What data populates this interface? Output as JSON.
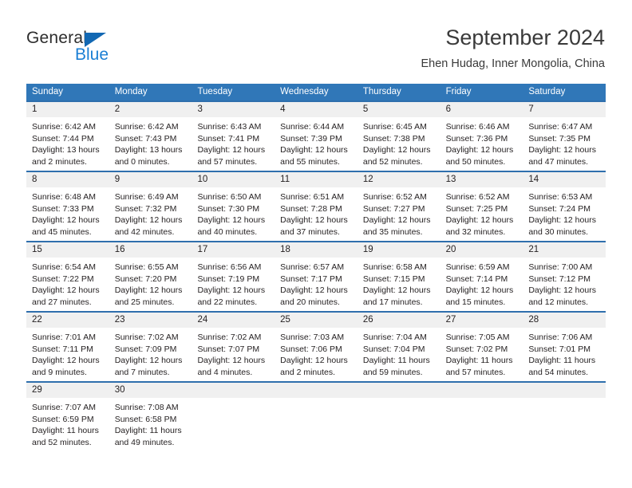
{
  "brand": {
    "name_part1": "General",
    "name_part2": "Blue",
    "logo_icon": "blue-triangle-icon"
  },
  "header": {
    "title": "September 2024",
    "subtitle": "Ehen Hudag, Inner Mongolia, China"
  },
  "colors": {
    "header_blue": "#3077b8",
    "row_divider_blue": "#2f6fad",
    "day_number_bg": "#f0f0f0",
    "logo_blue": "#1b7fd4",
    "text": "#231f20"
  },
  "weekdays": [
    "Sunday",
    "Monday",
    "Tuesday",
    "Wednesday",
    "Thursday",
    "Friday",
    "Saturday"
  ],
  "labels": {
    "sunrise": "Sunrise:",
    "sunset": "Sunset:",
    "daylight": "Daylight:"
  },
  "weeks": [
    [
      {
        "day": "1",
        "sunrise": "Sunrise: 6:42 AM",
        "sunset": "Sunset: 7:44 PM",
        "daylight_l1": "Daylight: 13 hours",
        "daylight_l2": "and 2 minutes."
      },
      {
        "day": "2",
        "sunrise": "Sunrise: 6:42 AM",
        "sunset": "Sunset: 7:43 PM",
        "daylight_l1": "Daylight: 13 hours",
        "daylight_l2": "and 0 minutes."
      },
      {
        "day": "3",
        "sunrise": "Sunrise: 6:43 AM",
        "sunset": "Sunset: 7:41 PM",
        "daylight_l1": "Daylight: 12 hours",
        "daylight_l2": "and 57 minutes."
      },
      {
        "day": "4",
        "sunrise": "Sunrise: 6:44 AM",
        "sunset": "Sunset: 7:39 PM",
        "daylight_l1": "Daylight: 12 hours",
        "daylight_l2": "and 55 minutes."
      },
      {
        "day": "5",
        "sunrise": "Sunrise: 6:45 AM",
        "sunset": "Sunset: 7:38 PM",
        "daylight_l1": "Daylight: 12 hours",
        "daylight_l2": "and 52 minutes."
      },
      {
        "day": "6",
        "sunrise": "Sunrise: 6:46 AM",
        "sunset": "Sunset: 7:36 PM",
        "daylight_l1": "Daylight: 12 hours",
        "daylight_l2": "and 50 minutes."
      },
      {
        "day": "7",
        "sunrise": "Sunrise: 6:47 AM",
        "sunset": "Sunset: 7:35 PM",
        "daylight_l1": "Daylight: 12 hours",
        "daylight_l2": "and 47 minutes."
      }
    ],
    [
      {
        "day": "8",
        "sunrise": "Sunrise: 6:48 AM",
        "sunset": "Sunset: 7:33 PM",
        "daylight_l1": "Daylight: 12 hours",
        "daylight_l2": "and 45 minutes."
      },
      {
        "day": "9",
        "sunrise": "Sunrise: 6:49 AM",
        "sunset": "Sunset: 7:32 PM",
        "daylight_l1": "Daylight: 12 hours",
        "daylight_l2": "and 42 minutes."
      },
      {
        "day": "10",
        "sunrise": "Sunrise: 6:50 AM",
        "sunset": "Sunset: 7:30 PM",
        "daylight_l1": "Daylight: 12 hours",
        "daylight_l2": "and 40 minutes."
      },
      {
        "day": "11",
        "sunrise": "Sunrise: 6:51 AM",
        "sunset": "Sunset: 7:28 PM",
        "daylight_l1": "Daylight: 12 hours",
        "daylight_l2": "and 37 minutes."
      },
      {
        "day": "12",
        "sunrise": "Sunrise: 6:52 AM",
        "sunset": "Sunset: 7:27 PM",
        "daylight_l1": "Daylight: 12 hours",
        "daylight_l2": "and 35 minutes."
      },
      {
        "day": "13",
        "sunrise": "Sunrise: 6:52 AM",
        "sunset": "Sunset: 7:25 PM",
        "daylight_l1": "Daylight: 12 hours",
        "daylight_l2": "and 32 minutes."
      },
      {
        "day": "14",
        "sunrise": "Sunrise: 6:53 AM",
        "sunset": "Sunset: 7:24 PM",
        "daylight_l1": "Daylight: 12 hours",
        "daylight_l2": "and 30 minutes."
      }
    ],
    [
      {
        "day": "15",
        "sunrise": "Sunrise: 6:54 AM",
        "sunset": "Sunset: 7:22 PM",
        "daylight_l1": "Daylight: 12 hours",
        "daylight_l2": "and 27 minutes."
      },
      {
        "day": "16",
        "sunrise": "Sunrise: 6:55 AM",
        "sunset": "Sunset: 7:20 PM",
        "daylight_l1": "Daylight: 12 hours",
        "daylight_l2": "and 25 minutes."
      },
      {
        "day": "17",
        "sunrise": "Sunrise: 6:56 AM",
        "sunset": "Sunset: 7:19 PM",
        "daylight_l1": "Daylight: 12 hours",
        "daylight_l2": "and 22 minutes."
      },
      {
        "day": "18",
        "sunrise": "Sunrise: 6:57 AM",
        "sunset": "Sunset: 7:17 PM",
        "daylight_l1": "Daylight: 12 hours",
        "daylight_l2": "and 20 minutes."
      },
      {
        "day": "19",
        "sunrise": "Sunrise: 6:58 AM",
        "sunset": "Sunset: 7:15 PM",
        "daylight_l1": "Daylight: 12 hours",
        "daylight_l2": "and 17 minutes."
      },
      {
        "day": "20",
        "sunrise": "Sunrise: 6:59 AM",
        "sunset": "Sunset: 7:14 PM",
        "daylight_l1": "Daylight: 12 hours",
        "daylight_l2": "and 15 minutes."
      },
      {
        "day": "21",
        "sunrise": "Sunrise: 7:00 AM",
        "sunset": "Sunset: 7:12 PM",
        "daylight_l1": "Daylight: 12 hours",
        "daylight_l2": "and 12 minutes."
      }
    ],
    [
      {
        "day": "22",
        "sunrise": "Sunrise: 7:01 AM",
        "sunset": "Sunset: 7:11 PM",
        "daylight_l1": "Daylight: 12 hours",
        "daylight_l2": "and 9 minutes."
      },
      {
        "day": "23",
        "sunrise": "Sunrise: 7:02 AM",
        "sunset": "Sunset: 7:09 PM",
        "daylight_l1": "Daylight: 12 hours",
        "daylight_l2": "and 7 minutes."
      },
      {
        "day": "24",
        "sunrise": "Sunrise: 7:02 AM",
        "sunset": "Sunset: 7:07 PM",
        "daylight_l1": "Daylight: 12 hours",
        "daylight_l2": "and 4 minutes."
      },
      {
        "day": "25",
        "sunrise": "Sunrise: 7:03 AM",
        "sunset": "Sunset: 7:06 PM",
        "daylight_l1": "Daylight: 12 hours",
        "daylight_l2": "and 2 minutes."
      },
      {
        "day": "26",
        "sunrise": "Sunrise: 7:04 AM",
        "sunset": "Sunset: 7:04 PM",
        "daylight_l1": "Daylight: 11 hours",
        "daylight_l2": "and 59 minutes."
      },
      {
        "day": "27",
        "sunrise": "Sunrise: 7:05 AM",
        "sunset": "Sunset: 7:02 PM",
        "daylight_l1": "Daylight: 11 hours",
        "daylight_l2": "and 57 minutes."
      },
      {
        "day": "28",
        "sunrise": "Sunrise: 7:06 AM",
        "sunset": "Sunset: 7:01 PM",
        "daylight_l1": "Daylight: 11 hours",
        "daylight_l2": "and 54 minutes."
      }
    ],
    [
      {
        "day": "29",
        "sunrise": "Sunrise: 7:07 AM",
        "sunset": "Sunset: 6:59 PM",
        "daylight_l1": "Daylight: 11 hours",
        "daylight_l2": "and 52 minutes."
      },
      {
        "day": "30",
        "sunrise": "Sunrise: 7:08 AM",
        "sunset": "Sunset: 6:58 PM",
        "daylight_l1": "Daylight: 11 hours",
        "daylight_l2": "and 49 minutes."
      },
      {
        "day": "",
        "sunrise": "",
        "sunset": "",
        "daylight_l1": "",
        "daylight_l2": ""
      },
      {
        "day": "",
        "sunrise": "",
        "sunset": "",
        "daylight_l1": "",
        "daylight_l2": ""
      },
      {
        "day": "",
        "sunrise": "",
        "sunset": "",
        "daylight_l1": "",
        "daylight_l2": ""
      },
      {
        "day": "",
        "sunrise": "",
        "sunset": "",
        "daylight_l1": "",
        "daylight_l2": ""
      },
      {
        "day": "",
        "sunrise": "",
        "sunset": "",
        "daylight_l1": "",
        "daylight_l2": ""
      }
    ]
  ]
}
